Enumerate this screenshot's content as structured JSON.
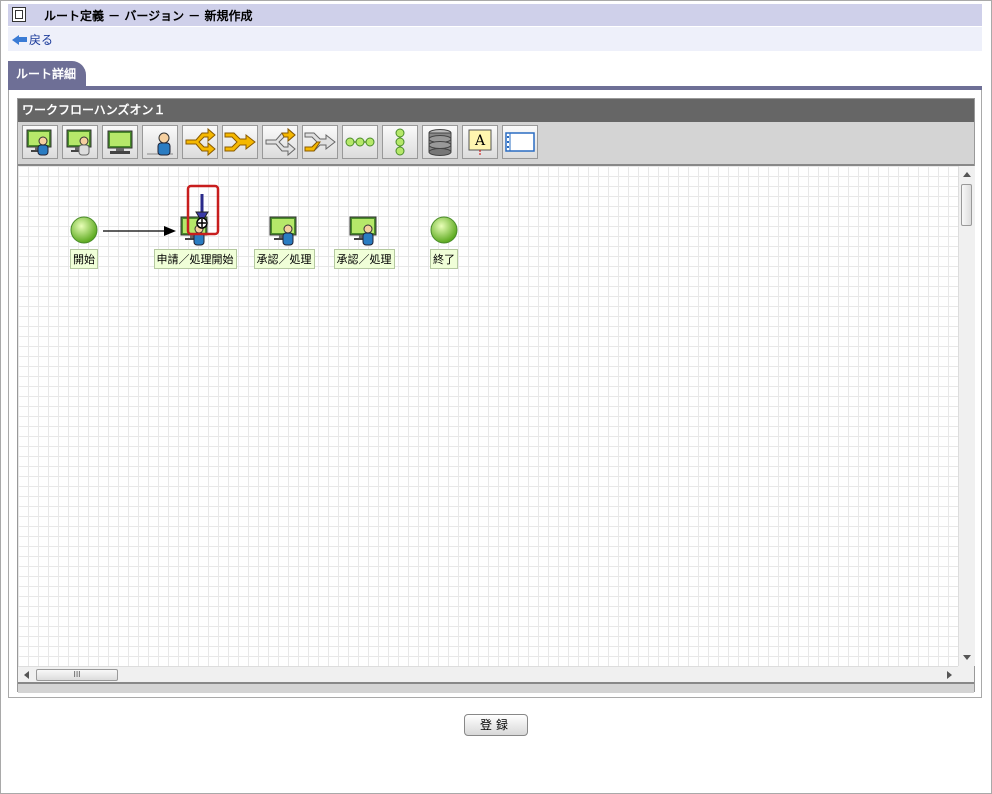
{
  "header": {
    "title": "ルート定義 － バージョン － 新規作成"
  },
  "nav": {
    "back_label": "戻る"
  },
  "tabs": [
    {
      "label": "ルート詳細"
    }
  ],
  "workflow": {
    "name": "ワークフローハンズオン１"
  },
  "toolbar": {
    "buttons": [
      "approval-user-icon",
      "approval-user-alt-icon",
      "monitor-icon",
      "person-icon",
      "branch-icon",
      "merge-icon",
      "branch-alt-icon",
      "merge-alt-icon",
      "horizontal-flow-icon",
      "vertical-flow-icon",
      "database-icon",
      "text-annotation-icon",
      "frame-icon"
    ]
  },
  "nodes": [
    {
      "id": "start",
      "label": "開始",
      "type": "start"
    },
    {
      "id": "apply",
      "label": "申請／処理開始",
      "type": "task"
    },
    {
      "id": "approve1",
      "label": "承認／処理",
      "type": "task"
    },
    {
      "id": "approve2",
      "label": "承認／処理",
      "type": "task"
    },
    {
      "id": "end",
      "label": "終了",
      "type": "end"
    }
  ],
  "scrollbar": {
    "thumb_label": "III"
  },
  "footer": {
    "submit_label": "登録"
  },
  "colors": {
    "accent": "#6e6f96",
    "title_bg": "#cfd0ea",
    "nav_bg": "#eef0fa",
    "highlight": "#c81e1e"
  }
}
